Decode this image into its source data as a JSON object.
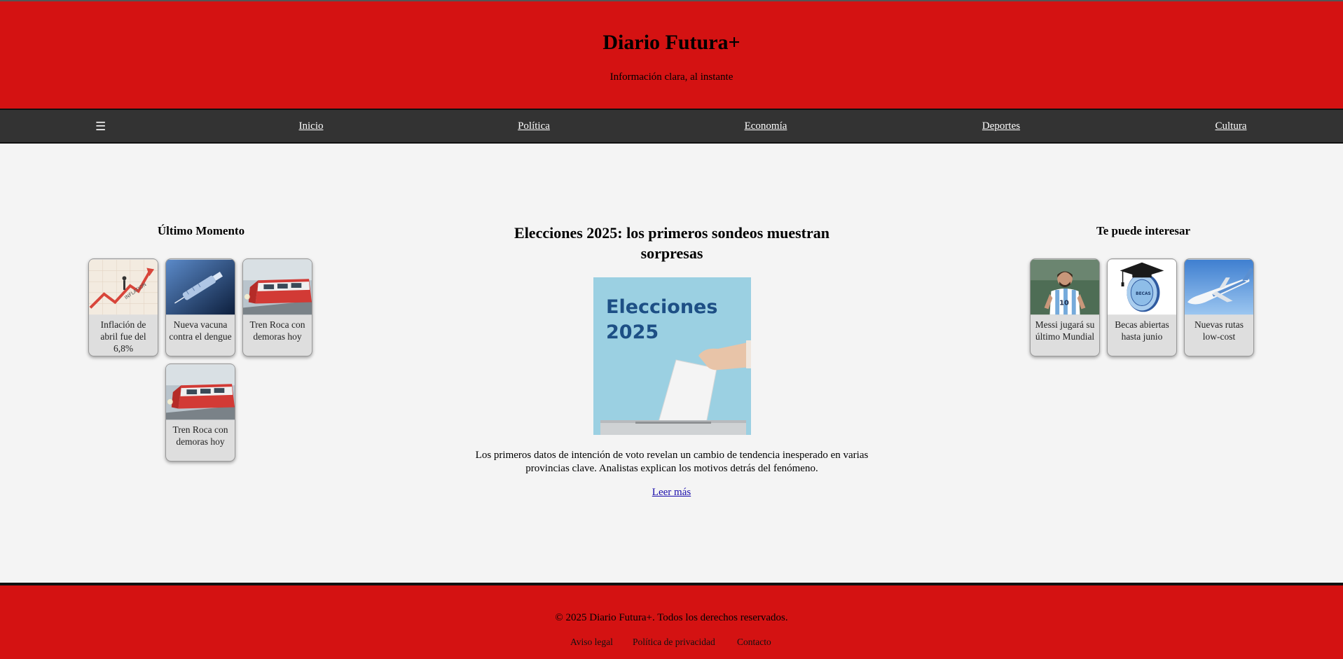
{
  "header": {
    "title": "Diario Futura+",
    "tagline": "Información clara, al instante"
  },
  "nav": {
    "menu_icon": "☰",
    "items": [
      {
        "label": "Inicio"
      },
      {
        "label": "Política"
      },
      {
        "label": "Economía"
      },
      {
        "label": "Deportes"
      },
      {
        "label": "Cultura"
      }
    ]
  },
  "latest": {
    "title": "Último Momento",
    "cards": [
      {
        "caption": "Inflación de abril fue del 6,8%",
        "thumb_word": "INFLATION"
      },
      {
        "caption": "Nueva vacuna contra el dengue"
      },
      {
        "caption": "Tren Roca con demoras hoy"
      },
      {
        "caption": "Tren Roca con demoras hoy"
      }
    ]
  },
  "article": {
    "title": "Elecciones 2025: los primeros sondeos muestran sorpresas",
    "image_text_line1": "Elecciones",
    "image_text_line2": "2025",
    "summary": "Los primeros datos de intención de voto revelan un cambio de tendencia inesperado en varias provincias clave. Analistas explican los motivos detrás del fenómeno.",
    "read_more": "Leer más"
  },
  "related": {
    "title": "Te puede interesar",
    "cards": [
      {
        "caption": "Messi jugará su último Mundial",
        "jersey_number": "10"
      },
      {
        "caption": "Becas abiertas hasta junio",
        "thumb_word": "BECAS"
      },
      {
        "caption": "Nuevas rutas low-cost"
      }
    ]
  },
  "footer": {
    "copyright": "© 2025 Diario Futura+. Todos los derechos reservados.",
    "links": [
      {
        "label": "Aviso legal"
      },
      {
        "label": "Política de privacidad"
      },
      {
        "label": "Contacto"
      }
    ]
  },
  "colors": {
    "brand_red": "#d41212",
    "nav_bg": "#333333",
    "page_bg": "#f4f4f4",
    "link_blue": "#1a0dab"
  }
}
